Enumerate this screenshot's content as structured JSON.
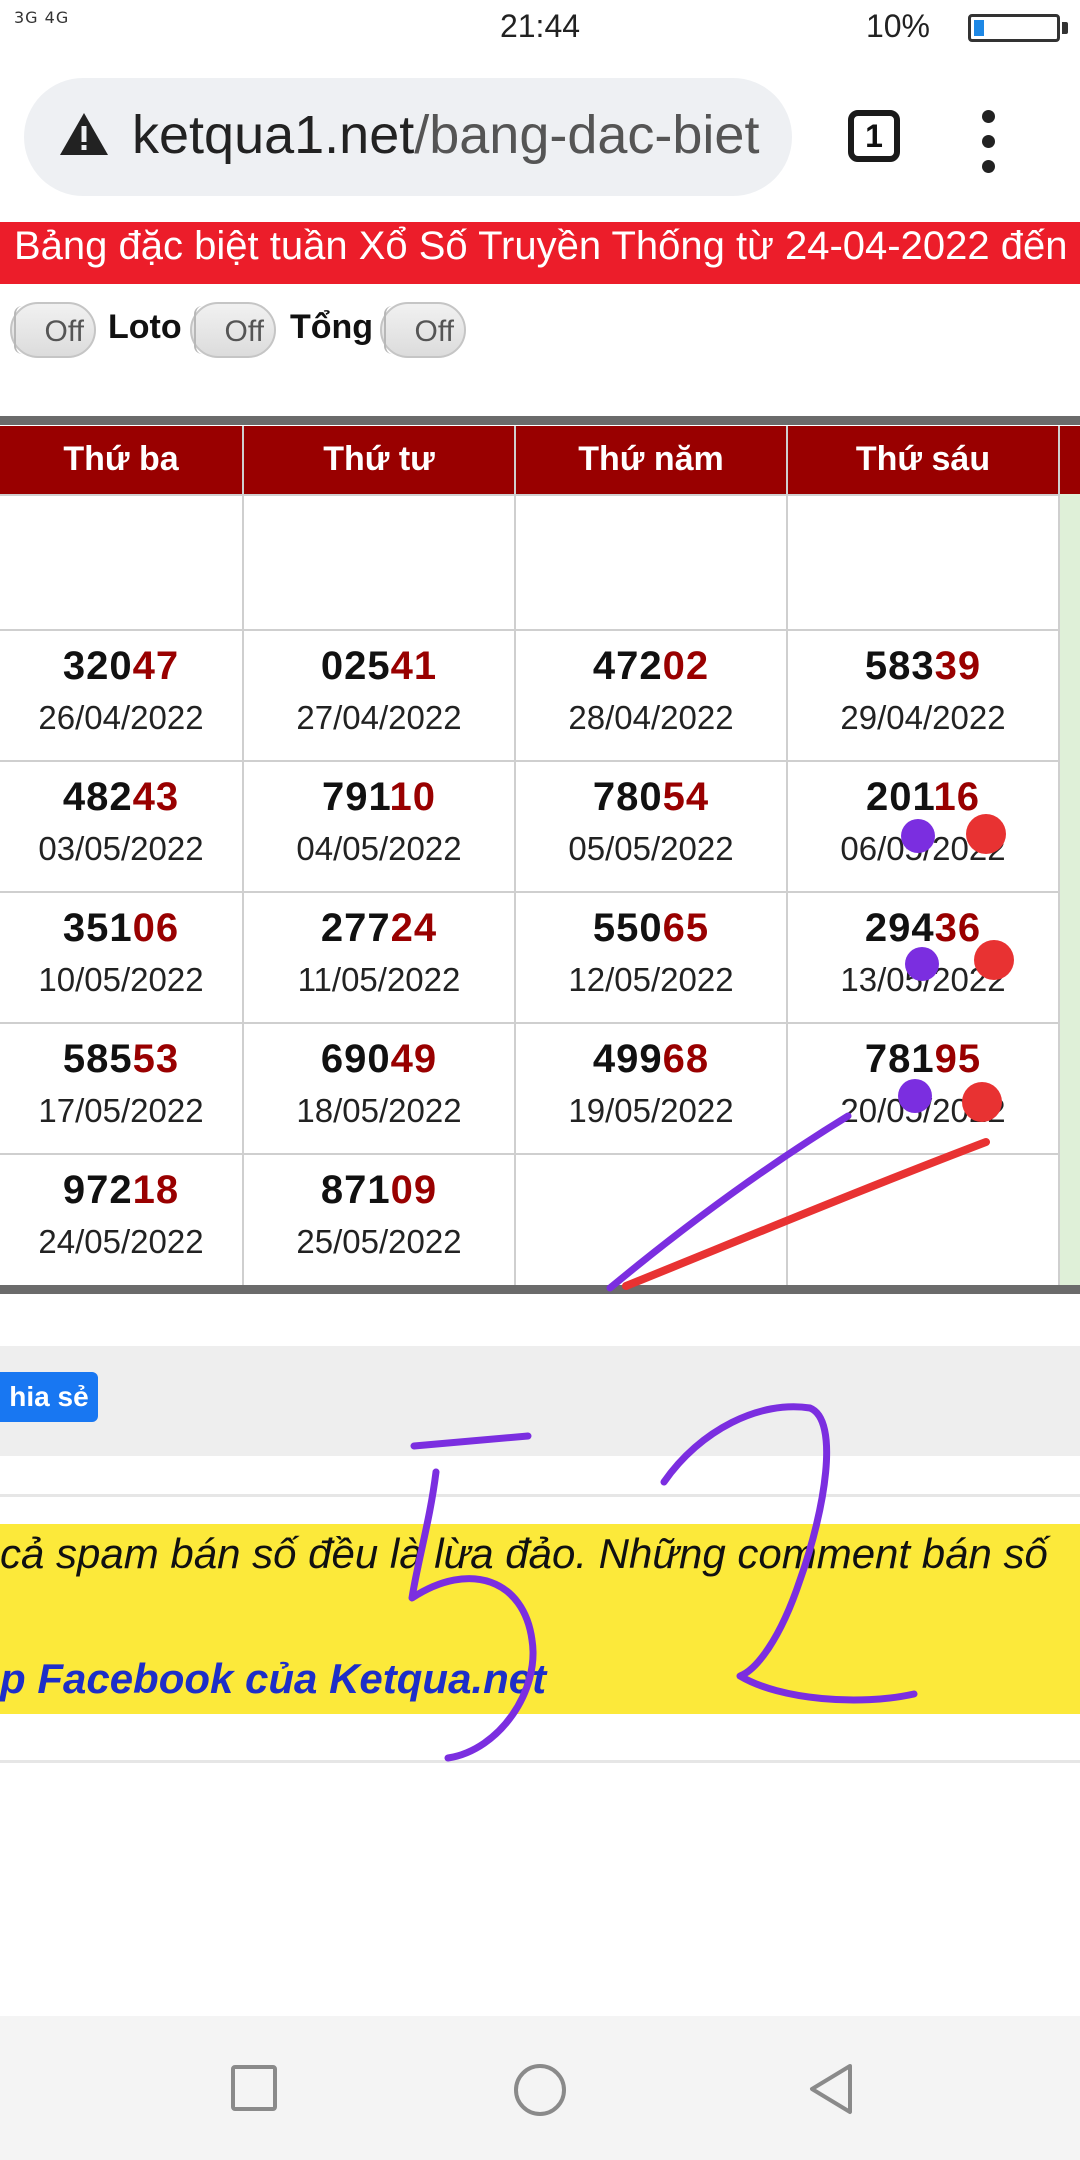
{
  "status_bar": {
    "signal": "3G 4G",
    "time": "21:44",
    "battery": "10%"
  },
  "browser": {
    "url_host": "ketqua1.net",
    "url_path": "/bang-dac-biet",
    "tab_count": "1"
  },
  "page": {
    "header_title": "Bảng đặc biệt tuần Xổ Số Truyền Thống từ 24-04-2022 đến",
    "toggles": [
      {
        "state": "Off"
      },
      {
        "label": "Loto",
        "state": "Off"
      },
      {
        "label": "Tổng",
        "state": "Off"
      }
    ],
    "table": {
      "columns": [
        "Thứ ba",
        "Thứ tư",
        "Thứ năm",
        "Thứ sáu"
      ],
      "rows": [
        [
          {
            "head": "320",
            "tail": "47",
            "date": "26/04/2022"
          },
          {
            "head": "025",
            "tail": "41",
            "date": "27/04/2022"
          },
          {
            "head": "472",
            "tail": "02",
            "date": "28/04/2022"
          },
          {
            "head": "583",
            "tail": "39",
            "date": "29/04/2022"
          }
        ],
        [
          {
            "head": "482",
            "tail": "43",
            "date": "03/05/2022"
          },
          {
            "head": "791",
            "tail": "10",
            "date": "04/05/2022"
          },
          {
            "head": "780",
            "tail": "54",
            "date": "05/05/2022"
          },
          {
            "head": "201",
            "tail": "16",
            "date": "06/05/2022"
          }
        ],
        [
          {
            "head": "351",
            "tail": "06",
            "date": "10/05/2022"
          },
          {
            "head": "277",
            "tail": "24",
            "date": "11/05/2022"
          },
          {
            "head": "550",
            "tail": "65",
            "date": "12/05/2022"
          },
          {
            "head": "294",
            "tail": "36",
            "date": "13/05/2022"
          }
        ],
        [
          {
            "head": "585",
            "tail": "53",
            "date": "17/05/2022"
          },
          {
            "head": "690",
            "tail": "49",
            "date": "18/05/2022"
          },
          {
            "head": "499",
            "tail": "68",
            "date": "19/05/2022"
          },
          {
            "head": "781",
            "tail": "95",
            "date": "20/05/2022"
          }
        ],
        [
          {
            "head": "972",
            "tail": "18",
            "date": "24/05/2022"
          },
          {
            "head": "871",
            "tail": "09",
            "date": "25/05/2022"
          }
        ]
      ]
    },
    "share_label": "hia sẻ",
    "notice_line1": "cả spam bán số đều là lừa đảo. Những comment bán số",
    "notice_line2": "p Facebook của Ketqua.net"
  },
  "colors": {
    "header_red": "#ec1d2a",
    "table_header": "#990000",
    "tail_digits": "#990000",
    "purple_ink": "#7b2ee0",
    "red_ink": "#e83232"
  }
}
